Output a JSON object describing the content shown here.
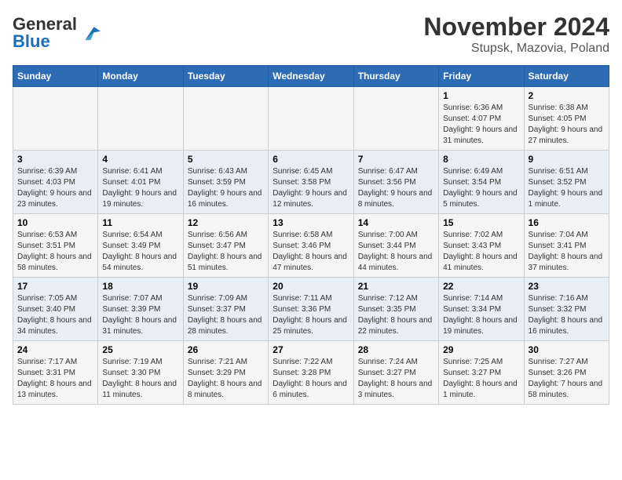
{
  "logo": {
    "text_general": "General",
    "text_blue": "Blue"
  },
  "title": "November 2024",
  "subtitle": "Stupsk, Mazovia, Poland",
  "headers": [
    "Sunday",
    "Monday",
    "Tuesday",
    "Wednesday",
    "Thursday",
    "Friday",
    "Saturday"
  ],
  "weeks": [
    {
      "days": [
        {
          "num": "",
          "info": ""
        },
        {
          "num": "",
          "info": ""
        },
        {
          "num": "",
          "info": ""
        },
        {
          "num": "",
          "info": ""
        },
        {
          "num": "",
          "info": ""
        },
        {
          "num": "1",
          "info": "Sunrise: 6:36 AM\nSunset: 4:07 PM\nDaylight: 9 hours and 31 minutes."
        },
        {
          "num": "2",
          "info": "Sunrise: 6:38 AM\nSunset: 4:05 PM\nDaylight: 9 hours and 27 minutes."
        }
      ]
    },
    {
      "days": [
        {
          "num": "3",
          "info": "Sunrise: 6:39 AM\nSunset: 4:03 PM\nDaylight: 9 hours and 23 minutes."
        },
        {
          "num": "4",
          "info": "Sunrise: 6:41 AM\nSunset: 4:01 PM\nDaylight: 9 hours and 19 minutes."
        },
        {
          "num": "5",
          "info": "Sunrise: 6:43 AM\nSunset: 3:59 PM\nDaylight: 9 hours and 16 minutes."
        },
        {
          "num": "6",
          "info": "Sunrise: 6:45 AM\nSunset: 3:58 PM\nDaylight: 9 hours and 12 minutes."
        },
        {
          "num": "7",
          "info": "Sunrise: 6:47 AM\nSunset: 3:56 PM\nDaylight: 9 hours and 8 minutes."
        },
        {
          "num": "8",
          "info": "Sunrise: 6:49 AM\nSunset: 3:54 PM\nDaylight: 9 hours and 5 minutes."
        },
        {
          "num": "9",
          "info": "Sunrise: 6:51 AM\nSunset: 3:52 PM\nDaylight: 9 hours and 1 minute."
        }
      ]
    },
    {
      "days": [
        {
          "num": "10",
          "info": "Sunrise: 6:53 AM\nSunset: 3:51 PM\nDaylight: 8 hours and 58 minutes."
        },
        {
          "num": "11",
          "info": "Sunrise: 6:54 AM\nSunset: 3:49 PM\nDaylight: 8 hours and 54 minutes."
        },
        {
          "num": "12",
          "info": "Sunrise: 6:56 AM\nSunset: 3:47 PM\nDaylight: 8 hours and 51 minutes."
        },
        {
          "num": "13",
          "info": "Sunrise: 6:58 AM\nSunset: 3:46 PM\nDaylight: 8 hours and 47 minutes."
        },
        {
          "num": "14",
          "info": "Sunrise: 7:00 AM\nSunset: 3:44 PM\nDaylight: 8 hours and 44 minutes."
        },
        {
          "num": "15",
          "info": "Sunrise: 7:02 AM\nSunset: 3:43 PM\nDaylight: 8 hours and 41 minutes."
        },
        {
          "num": "16",
          "info": "Sunrise: 7:04 AM\nSunset: 3:41 PM\nDaylight: 8 hours and 37 minutes."
        }
      ]
    },
    {
      "days": [
        {
          "num": "17",
          "info": "Sunrise: 7:05 AM\nSunset: 3:40 PM\nDaylight: 8 hours and 34 minutes."
        },
        {
          "num": "18",
          "info": "Sunrise: 7:07 AM\nSunset: 3:39 PM\nDaylight: 8 hours and 31 minutes."
        },
        {
          "num": "19",
          "info": "Sunrise: 7:09 AM\nSunset: 3:37 PM\nDaylight: 8 hours and 28 minutes."
        },
        {
          "num": "20",
          "info": "Sunrise: 7:11 AM\nSunset: 3:36 PM\nDaylight: 8 hours and 25 minutes."
        },
        {
          "num": "21",
          "info": "Sunrise: 7:12 AM\nSunset: 3:35 PM\nDaylight: 8 hours and 22 minutes."
        },
        {
          "num": "22",
          "info": "Sunrise: 7:14 AM\nSunset: 3:34 PM\nDaylight: 8 hours and 19 minutes."
        },
        {
          "num": "23",
          "info": "Sunrise: 7:16 AM\nSunset: 3:32 PM\nDaylight: 8 hours and 16 minutes."
        }
      ]
    },
    {
      "days": [
        {
          "num": "24",
          "info": "Sunrise: 7:17 AM\nSunset: 3:31 PM\nDaylight: 8 hours and 13 minutes."
        },
        {
          "num": "25",
          "info": "Sunrise: 7:19 AM\nSunset: 3:30 PM\nDaylight: 8 hours and 11 minutes."
        },
        {
          "num": "26",
          "info": "Sunrise: 7:21 AM\nSunset: 3:29 PM\nDaylight: 8 hours and 8 minutes."
        },
        {
          "num": "27",
          "info": "Sunrise: 7:22 AM\nSunset: 3:28 PM\nDaylight: 8 hours and 6 minutes."
        },
        {
          "num": "28",
          "info": "Sunrise: 7:24 AM\nSunset: 3:27 PM\nDaylight: 8 hours and 3 minutes."
        },
        {
          "num": "29",
          "info": "Sunrise: 7:25 AM\nSunset: 3:27 PM\nDaylight: 8 hours and 1 minute."
        },
        {
          "num": "30",
          "info": "Sunrise: 7:27 AM\nSunset: 3:26 PM\nDaylight: 7 hours and 58 minutes."
        }
      ]
    }
  ]
}
